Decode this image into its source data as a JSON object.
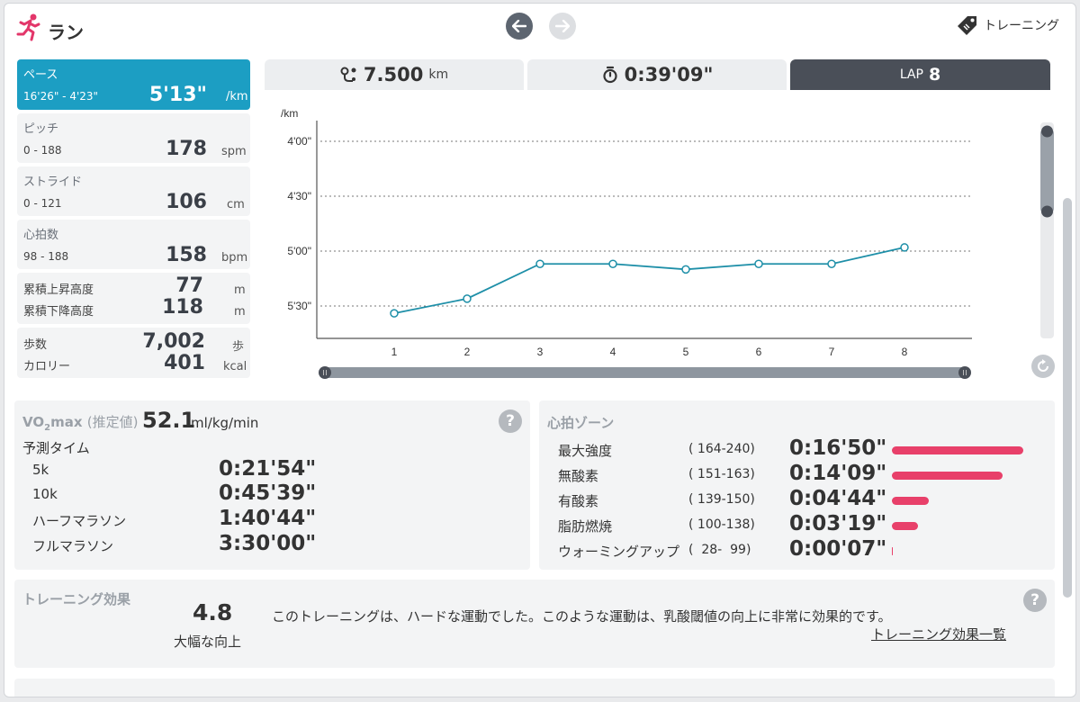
{
  "header": {
    "title": "ラン",
    "tag_label": "トレーニング",
    "accent_color": "#e3366a"
  },
  "metrics": {
    "pace": {
      "label": "ペース",
      "range": "16'26\" - 4'23\"",
      "value": "5'13\"",
      "unit": "/km"
    },
    "pitch": {
      "label": "ピッチ",
      "range": "0 - 188",
      "value": "178",
      "unit": "spm"
    },
    "stride": {
      "label": "ストライド",
      "range": "0 - 121",
      "value": "106",
      "unit": "cm"
    },
    "heart_rate": {
      "label": "心拍数",
      "range": "98 - 188",
      "value": "158",
      "unit": "bpm"
    },
    "ascent": {
      "label": "累積上昇高度",
      "value": "77",
      "unit": "m"
    },
    "descent": {
      "label": "累積下降高度",
      "value": "118",
      "unit": "m"
    },
    "steps": {
      "label": "歩数",
      "value": "7,002",
      "unit": "歩"
    },
    "calories": {
      "label": "カロリー",
      "value": "401",
      "unit": "kcal"
    }
  },
  "tabs": {
    "distance": {
      "value": "7.500",
      "unit": "km"
    },
    "duration": {
      "value": "0:39'09\""
    },
    "lap": {
      "label": "LAP",
      "value": "8"
    }
  },
  "chart": {
    "y_unit": "/km",
    "y_ticks": [
      "4'00\"",
      "4'30\"",
      "5'00\"",
      "5'30\""
    ],
    "x_ticks": [
      "1",
      "2",
      "3",
      "4",
      "5",
      "6",
      "7",
      "8"
    ],
    "line_color": "#1e8fa8"
  },
  "chart_data": {
    "type": "line",
    "x": [
      1,
      2,
      3,
      4,
      5,
      6,
      7,
      8
    ],
    "values_seconds_per_km": [
      334,
      326,
      307,
      307,
      310,
      307,
      307,
      298
    ],
    "values": [
      "5'34\"",
      "5'26\"",
      "5'07\"",
      "5'07\"",
      "5'10\"",
      "5'07\"",
      "5'07\"",
      "4'58\""
    ],
    "ylabel": "/km",
    "ylim_seconds": [
      225,
      345
    ],
    "y_inverted": true,
    "grid": true
  },
  "vo2": {
    "label": "VO",
    "label_sub": "2",
    "label_suffix": "max",
    "estimate": "(推定値)",
    "value": "52.1",
    "unit": "ml/kg/min",
    "predicted_title": "予測タイム",
    "predictions": [
      {
        "name": "5k",
        "time": "0:21'54\""
      },
      {
        "name": "10k",
        "time": "0:45'39\""
      },
      {
        "name": "ハーフマラソン",
        "time": "1:40'44\""
      },
      {
        "name": "フルマラソン",
        "time": "3:30'00\""
      }
    ]
  },
  "hr_zones": {
    "title": "心拍ゾーン",
    "bar_color": "#e8406a",
    "zones": [
      {
        "name": "最大強度",
        "range": "( 164-240)",
        "time": "0:16'50\"",
        "fraction": 1.0
      },
      {
        "name": "無酸素",
        "range": "( 151-163)",
        "time": "0:14'09\"",
        "fraction": 0.84
      },
      {
        "name": "有酸素",
        "range": "( 139-150)",
        "time": "0:04'44\"",
        "fraction": 0.28
      },
      {
        "name": "脂肪燃焼",
        "range": "( 100-138)",
        "time": "0:03'19\"",
        "fraction": 0.2
      },
      {
        "name": "ウォーミングアップ",
        "range": "(  28-  99)",
        "time": "0:00'07\"",
        "fraction": 0.007
      }
    ]
  },
  "training_effect": {
    "title": "トレーニング効果",
    "score": "4.8",
    "score_label": "大幅な向上",
    "description": "このトレーニングは、ハードな運動でした。このような運動は、乳酸閾値の向上に非常に効果的です。",
    "list_link": "トレーニング効果一覧"
  }
}
